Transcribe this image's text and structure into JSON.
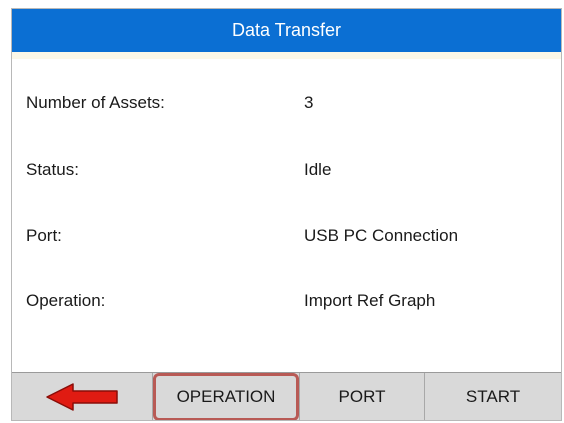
{
  "header": {
    "title": "Data Transfer"
  },
  "fields": [
    {
      "label": "Number of Assets:",
      "value": "3"
    },
    {
      "label": "Status:",
      "value": "Idle"
    },
    {
      "label": "Port:",
      "value": "USB PC Connection"
    },
    {
      "label": "Operation:",
      "value": "Import Ref Graph"
    }
  ],
  "softkeys": {
    "back_icon": "left-arrow-icon",
    "operation": "OPERATION",
    "port": "PORT",
    "start": "START"
  },
  "colors": {
    "titlebar": "#0b6fd3",
    "arrow": "#e01b12",
    "highlight_outline": "#b85a55"
  }
}
